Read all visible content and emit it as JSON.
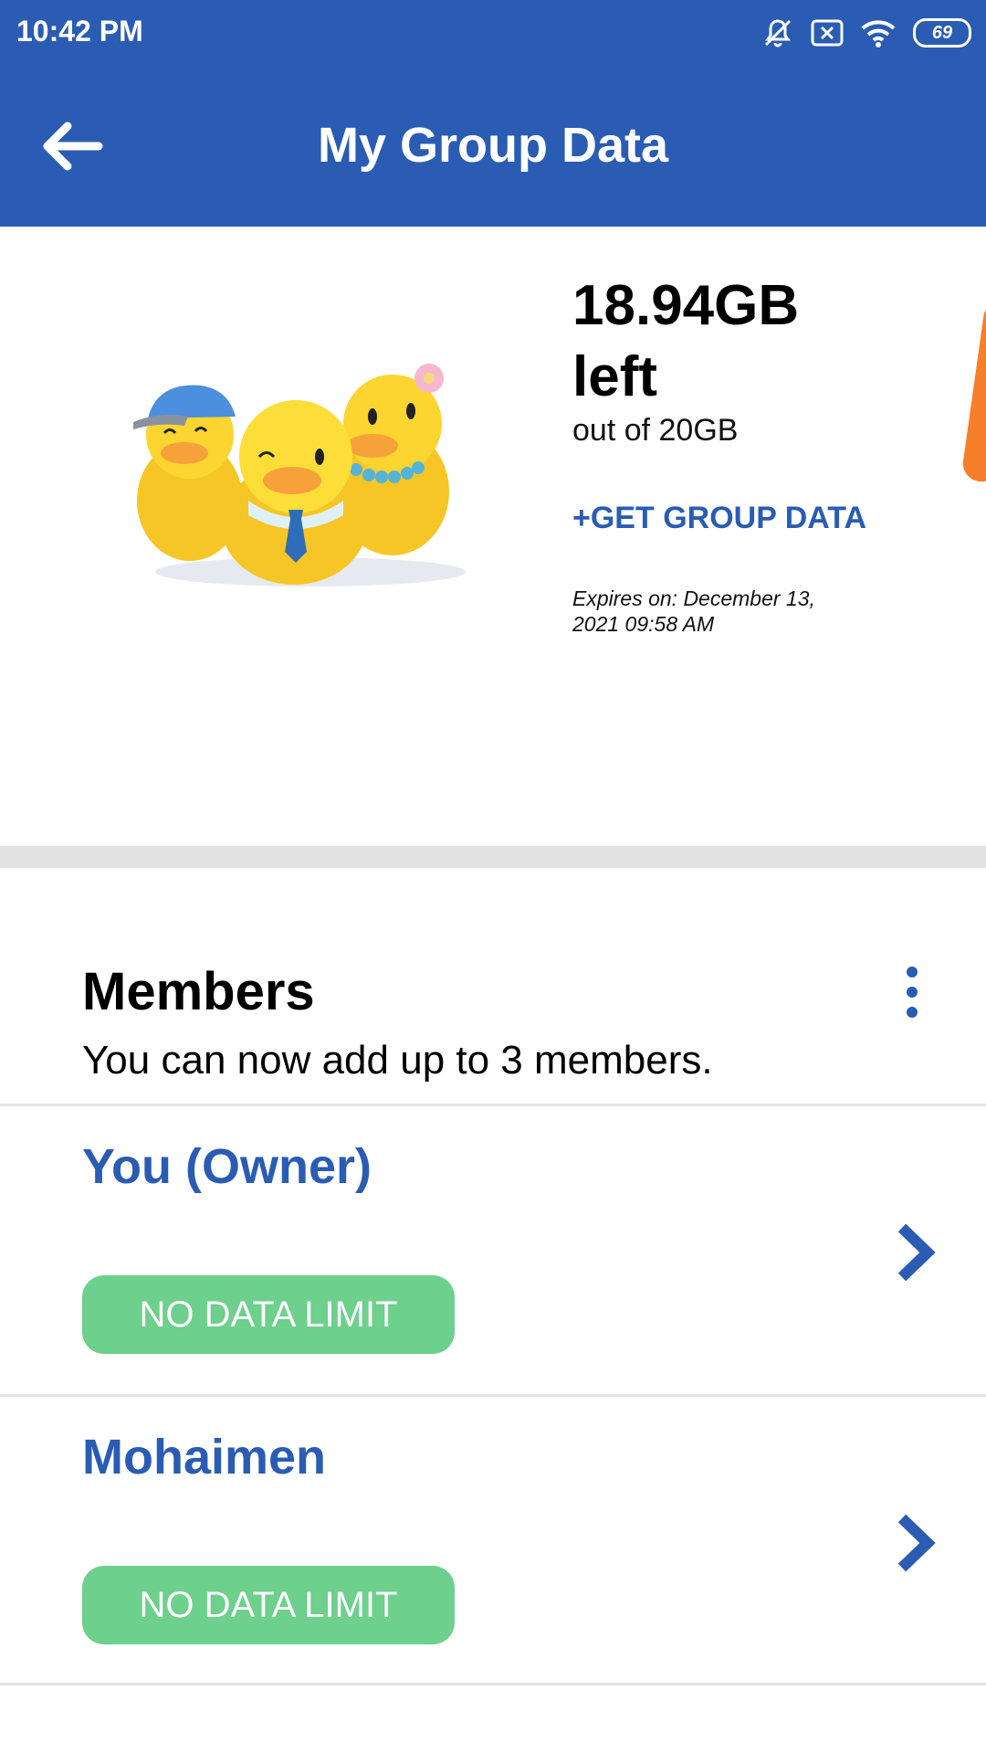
{
  "status_bar": {
    "time": "10:42 PM",
    "battery": "69"
  },
  "header": {
    "title": "My Group Data"
  },
  "summary": {
    "amount_left": "18.94GB",
    "left_word": "left",
    "out_of": "out of 20GB",
    "get_data_link": "+GET GROUP DATA",
    "expires_line1": "Expires on: December 13,",
    "expires_line2": "2021 09:58 AM"
  },
  "members": {
    "title": "Members",
    "subtitle": "You can now add up to 3 members.",
    "list": [
      {
        "name": "You (Owner)",
        "limit": "NO DATA LIMIT"
      },
      {
        "name": "Mohaimen",
        "limit": "NO DATA LIMIT"
      }
    ]
  },
  "colors": {
    "brand_blue": "#2a5cb3",
    "pill_green": "#6dd08c",
    "accent_orange": "#f57f2a"
  }
}
